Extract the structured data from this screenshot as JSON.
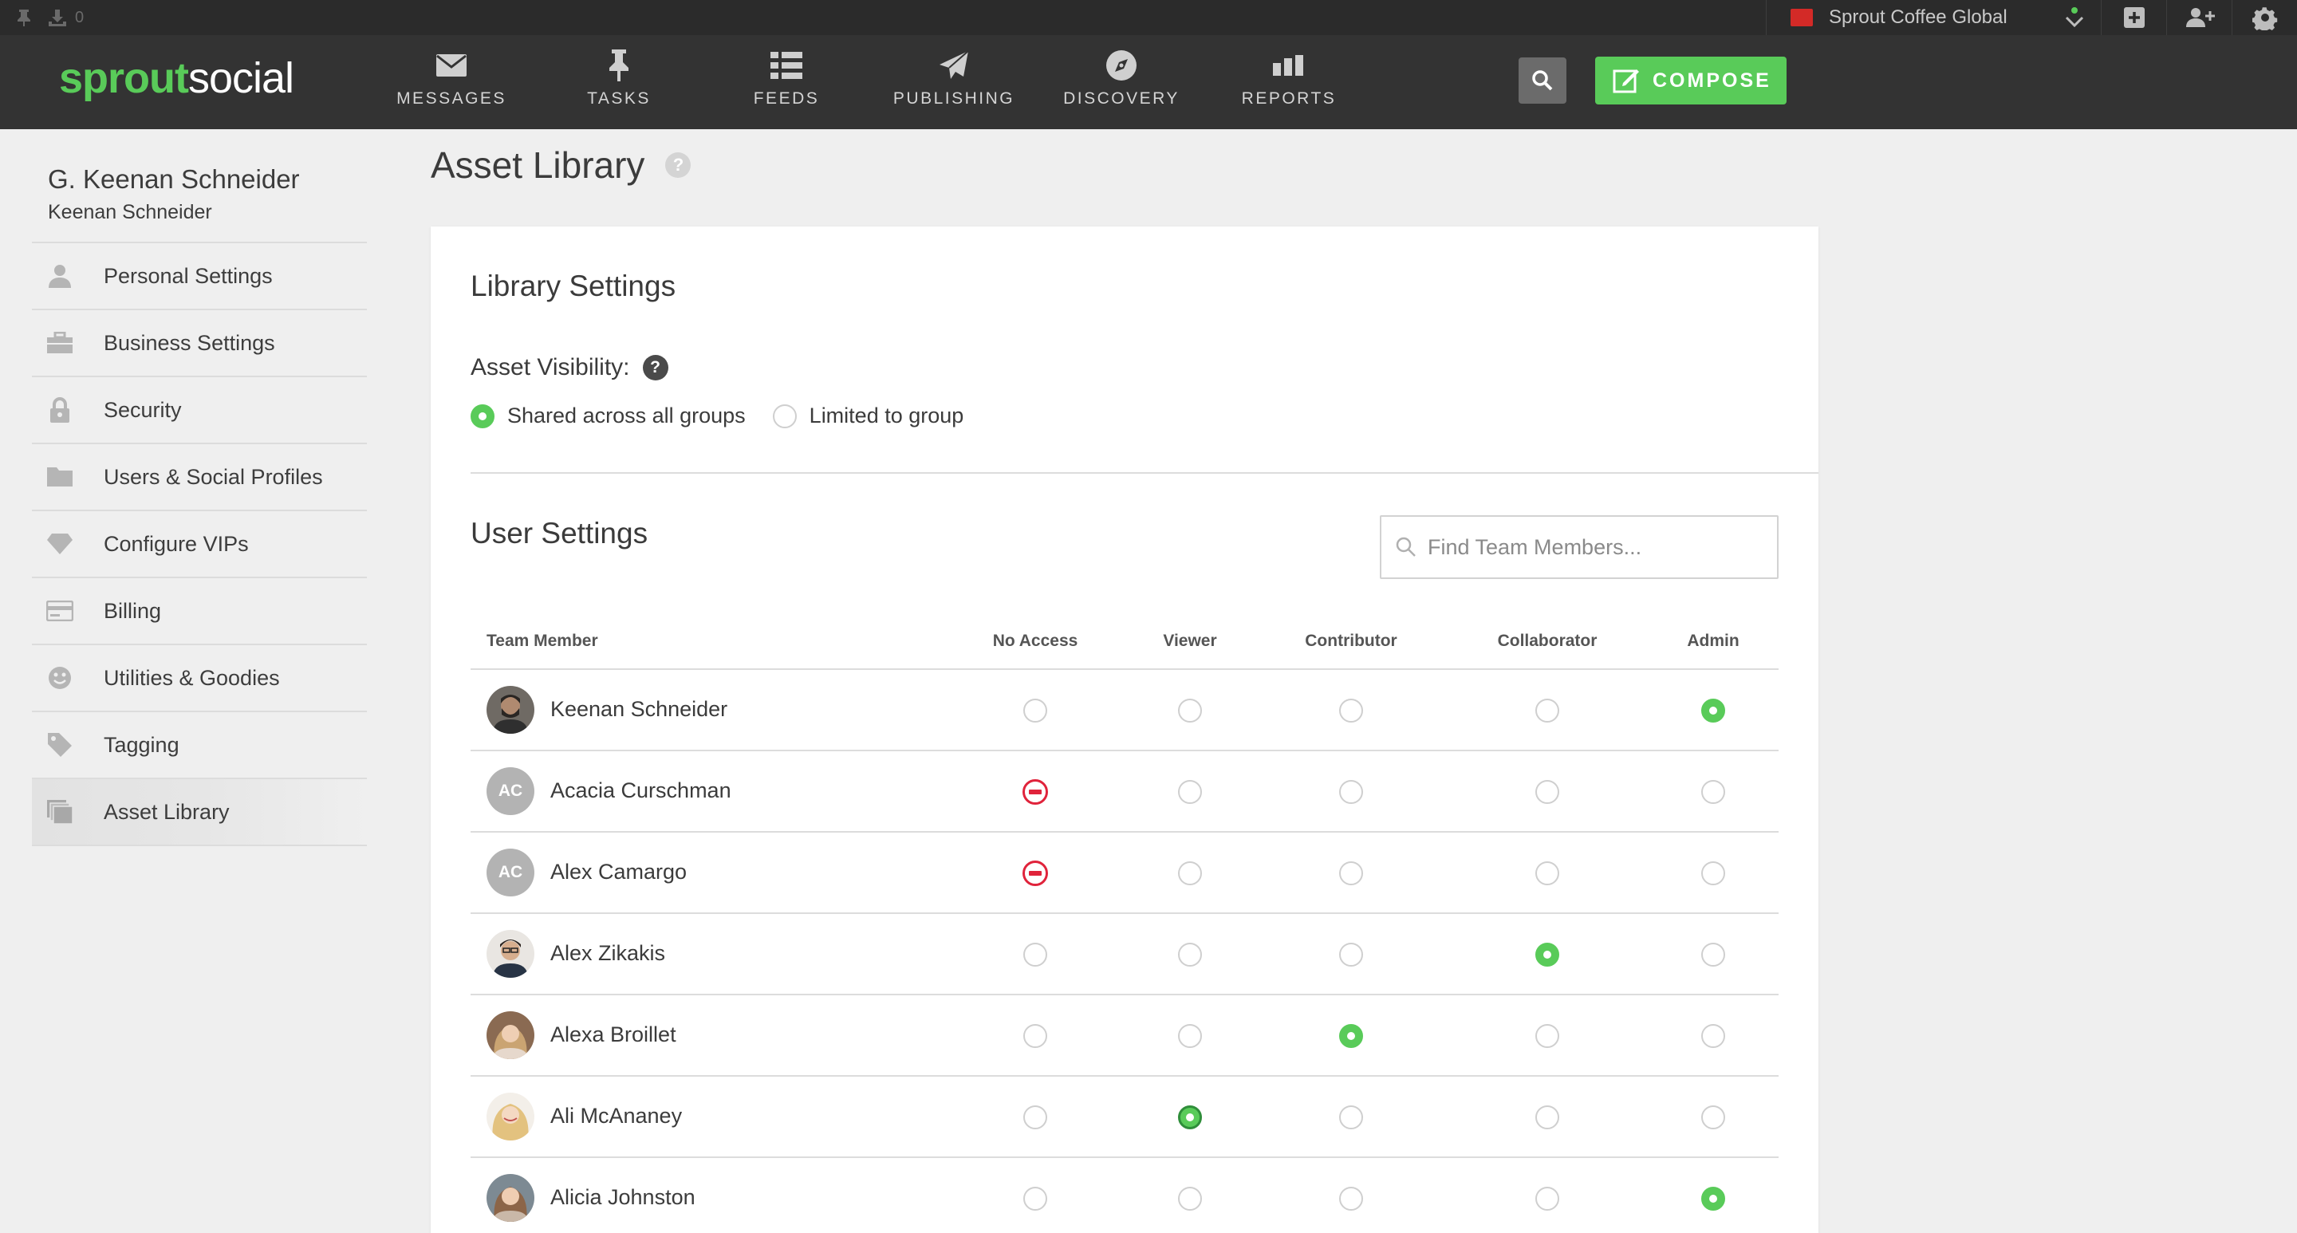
{
  "topbar": {
    "pin_count": "0",
    "brand_name": "Sprout Coffee Global",
    "brand_color": "#d32a27"
  },
  "nav": {
    "logo_part1": "sprout",
    "logo_part2": "social",
    "items": [
      {
        "label": "MESSAGES",
        "icon": "envelope-icon"
      },
      {
        "label": "TASKS",
        "icon": "pin-icon"
      },
      {
        "label": "FEEDS",
        "icon": "list-icon"
      },
      {
        "label": "PUBLISHING",
        "icon": "paper-plane-icon"
      },
      {
        "label": "DISCOVERY",
        "icon": "compass-icon"
      },
      {
        "label": "REPORTS",
        "icon": "bar-chart-icon"
      }
    ],
    "compose_label": "COMPOSE",
    "accent": "#59cb59"
  },
  "sidebar": {
    "name": "G. Keenan Schneider",
    "subname": "Keenan Schneider",
    "items": [
      {
        "label": "Personal Settings",
        "icon": "person-icon"
      },
      {
        "label": "Business Settings",
        "icon": "briefcase-icon"
      },
      {
        "label": "Security",
        "icon": "lock-icon"
      },
      {
        "label": "Users & Social Profiles",
        "icon": "folder-icon"
      },
      {
        "label": "Configure VIPs",
        "icon": "diamond-icon"
      },
      {
        "label": "Billing",
        "icon": "credit-card-icon"
      },
      {
        "label": "Utilities & Goodies",
        "icon": "smiley-icon"
      },
      {
        "label": "Tagging",
        "icon": "tag-icon"
      },
      {
        "label": "Asset Library",
        "icon": "stacked-images-icon",
        "active": true
      }
    ]
  },
  "main": {
    "title": "Asset Library",
    "help_glyph": "?",
    "library_settings": {
      "heading": "Library Settings",
      "visibility_label": "Asset Visibility:",
      "options": [
        "Shared across all groups",
        "Limited to group"
      ],
      "selected": "Shared across all groups"
    },
    "user_settings": {
      "heading": "User Settings",
      "search_placeholder": "Find Team Members...",
      "columns": [
        "Team Member",
        "No Access",
        "Viewer",
        "Contributor",
        "Collaborator",
        "Admin"
      ],
      "rows": [
        {
          "name": "Keenan Schneider",
          "initials": "",
          "role": "Admin"
        },
        {
          "name": "Acacia Curschman",
          "initials": "AC",
          "role": "No Access"
        },
        {
          "name": "Alex Camargo",
          "initials": "AC",
          "role": "No Access"
        },
        {
          "name": "Alex Zikakis",
          "initials": "",
          "role": "Collaborator"
        },
        {
          "name": "Alexa Broillet",
          "initials": "",
          "role": "Contributor"
        },
        {
          "name": "Ali McAnaney",
          "initials": "",
          "role": "Viewer"
        },
        {
          "name": "Alicia Johnston",
          "initials": "",
          "role": "Admin"
        }
      ]
    }
  }
}
